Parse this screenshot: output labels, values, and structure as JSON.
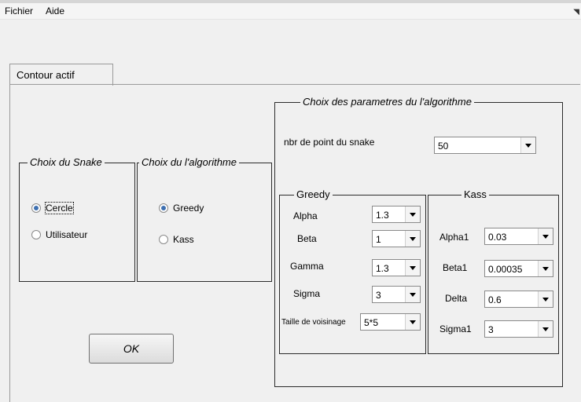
{
  "menu": {
    "file": "Fichier",
    "help": "Aide"
  },
  "tab": {
    "label": "Contour actif"
  },
  "snake": {
    "legend": "Choix du Snake",
    "options": [
      {
        "label": "Cercle",
        "selected": true
      },
      {
        "label": "Utilisateur",
        "selected": false
      }
    ]
  },
  "algo": {
    "legend": "Choix du l'algorithme",
    "options": [
      {
        "label": "Greedy",
        "selected": true
      },
      {
        "label": "Kass",
        "selected": false
      }
    ]
  },
  "params": {
    "legend": "Choix des parametres du l'algorithme",
    "nbr_label": "nbr de point du snake",
    "nbr_value": "50",
    "greedy": {
      "legend": "Greedy",
      "alpha_label": "Alpha",
      "alpha_value": "1.3",
      "beta_label": "Beta",
      "beta_value": "1",
      "gamma_label": "Gamma",
      "gamma_value": "1.3",
      "sigma_label": "Sigma",
      "sigma_value": "3",
      "taille_label": "Taille de voisinage",
      "taille_value": "5*5"
    },
    "kass": {
      "legend": "Kass",
      "alpha1_label": "Alpha1",
      "alpha1_value": "0.03",
      "beta1_label": "Beta1",
      "beta1_value": "0.00035",
      "delta_label": "Delta",
      "delta_value": "0.6",
      "sigma1_label": "Sigma1",
      "sigma1_value": "3"
    }
  },
  "ok_label": "OK",
  "colors": {
    "background": "#f0f0f0",
    "radio_selected": "#3d6fb0"
  }
}
